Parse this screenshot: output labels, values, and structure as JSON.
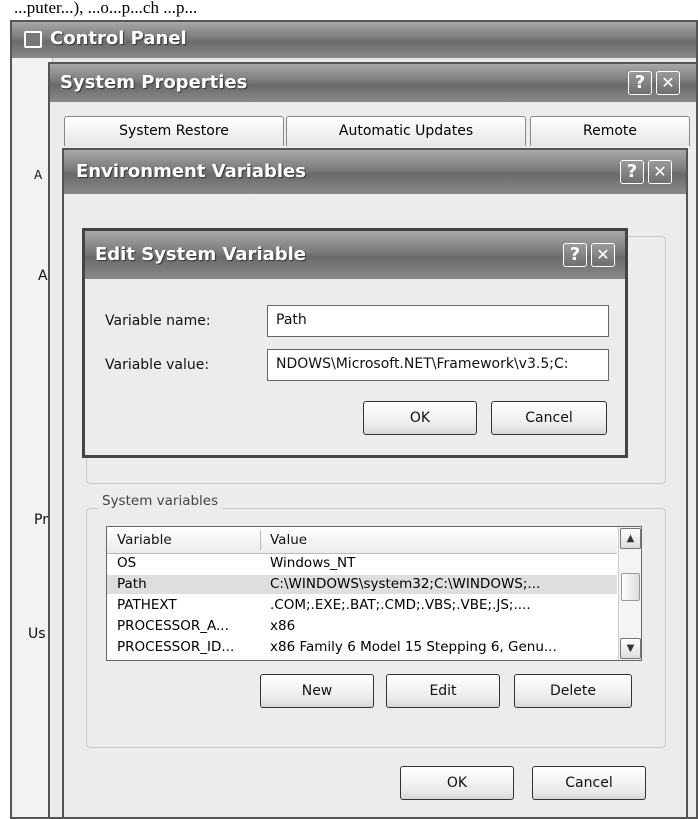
{
  "caption": "...puter...), ...o...p...ch ...p...",
  "control_panel": {
    "title": "Control Panel",
    "side_labels": [
      "A",
      "A",
      "Pr",
      "Us"
    ]
  },
  "system_properties": {
    "title": "System Properties",
    "help_glyph": "?",
    "close_glyph": "✕",
    "tabs": [
      "System Restore",
      "Automatic Updates",
      "Remote"
    ]
  },
  "environment_variables": {
    "title": "Environment Variables",
    "help_glyph": "?",
    "close_glyph": "✕",
    "system_variables_label": "System variables",
    "columns": [
      "Variable",
      "Value"
    ],
    "rows": [
      {
        "variable": "OS",
        "value": "Windows_NT"
      },
      {
        "variable": "Path",
        "value": "C:\\WINDOWS\\system32;C:\\WINDOWS;..."
      },
      {
        "variable": "PATHEXT",
        "value": ".COM;.EXE;.BAT;.CMD;.VBS;.VBE;.JS;...."
      },
      {
        "variable": "PROCESSOR_A...",
        "value": "x86"
      },
      {
        "variable": "PROCESSOR_ID...",
        "value": "x86 Family 6 Model 15 Stepping 6, Genu..."
      }
    ],
    "selected_row": 1,
    "new_label": "New",
    "edit_label": "Edit",
    "delete_label": "Delete",
    "ok_label": "OK",
    "cancel_label": "Cancel"
  },
  "edit_system_variable": {
    "title": "Edit System Variable",
    "help_glyph": "?",
    "close_glyph": "✕",
    "name_label": "Variable name:",
    "name_value": "Path",
    "value_label": "Variable value:",
    "value_value": "NDOWS\\Microsoft.NET\\Framework\\v3.5;C:",
    "ok_label": "OK",
    "cancel_label": "Cancel"
  },
  "icons": {
    "app_icon": "control-panel-icon",
    "scroll_up": "▲",
    "scroll_down": "▼"
  }
}
